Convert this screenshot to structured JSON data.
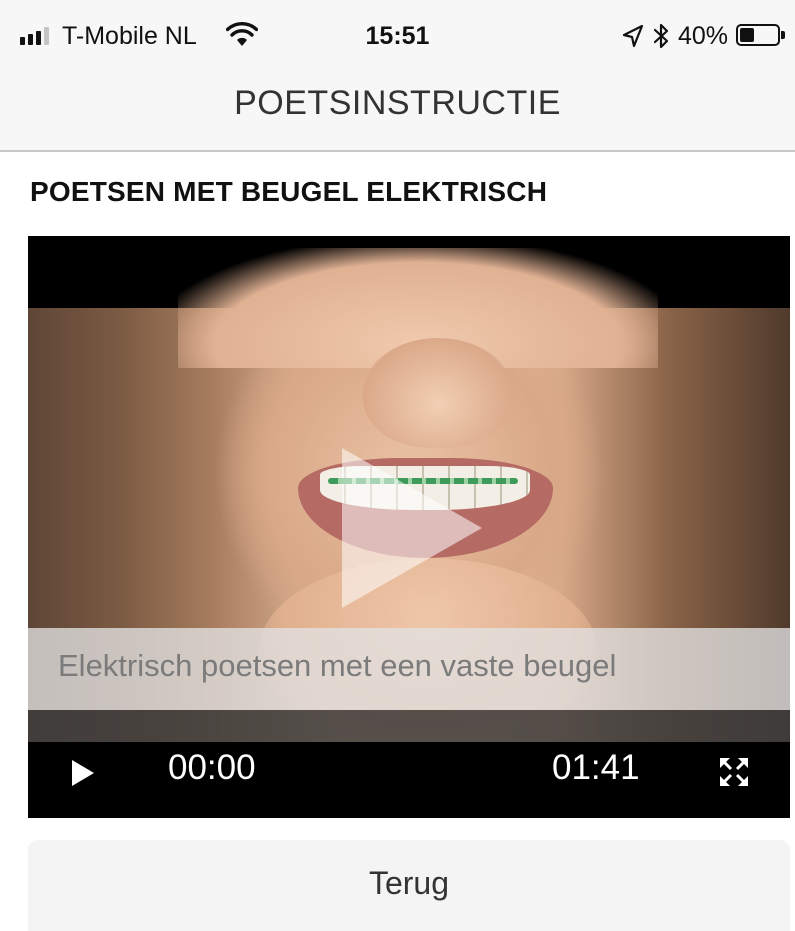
{
  "status_bar": {
    "carrier": "T-Mobile NL",
    "time": "15:51",
    "battery_percent": "40%",
    "battery_level": 0.4,
    "signal_bars_active": 3,
    "signal_bars_total": 4,
    "icons": [
      "signal-icon",
      "wifi-icon",
      "location-arrow-icon",
      "bluetooth-icon",
      "battery-icon"
    ]
  },
  "nav": {
    "title": "POETSINSTRUCTIE"
  },
  "content": {
    "section_title": "POETSEN MET BEUGEL ELEKTRISCH"
  },
  "video": {
    "caption": "Elektrisch poetsen met een vaste beugel",
    "current_time": "00:00",
    "duration": "01:41",
    "icons": [
      "play-overlay-icon",
      "play-icon",
      "fullscreen-icon"
    ]
  },
  "actions": {
    "back_label": "Terug"
  },
  "colors": {
    "bar_background": "#f7f7f7",
    "player_background": "#000000",
    "button_background": "#f4f4f4",
    "text": "#111111"
  }
}
